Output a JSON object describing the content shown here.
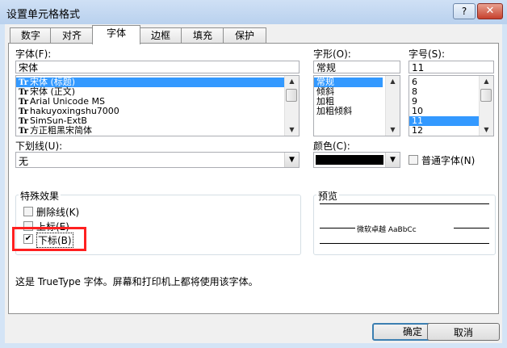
{
  "window": {
    "title": "设置单元格格式",
    "help_label": "?",
    "close_label": "✕"
  },
  "tabs": [
    {
      "label": "数字",
      "active": false
    },
    {
      "label": "对齐",
      "active": false
    },
    {
      "label": "字体",
      "active": true
    },
    {
      "label": "边框",
      "active": false
    },
    {
      "label": "填充",
      "active": false
    },
    {
      "label": "保护",
      "active": false
    }
  ],
  "font": {
    "label": "字体(F):",
    "value": "宋体",
    "items": [
      "宋体 (标题)",
      "宋体 (正文)",
      "Arial Unicode MS",
      "hakuyoxingshu7000",
      "SimSun-ExtB",
      "方正粗黑宋简体"
    ],
    "selected_index": 0,
    "icon_glyph": "Tr"
  },
  "style": {
    "label": "字形(O):",
    "value": "常规",
    "items": [
      "常规",
      "倾斜",
      "加粗",
      "加粗倾斜"
    ],
    "selected_index": 0
  },
  "size": {
    "label": "字号(S):",
    "value": "11",
    "items": [
      "6",
      "8",
      "9",
      "10",
      "11",
      "12"
    ],
    "selected_index": 4
  },
  "underline": {
    "label": "下划线(U):",
    "value": "无"
  },
  "color": {
    "label": "颜色(C):",
    "swatch": "#000000"
  },
  "normal_font": {
    "label": "普通字体(N)",
    "checked": false
  },
  "effects": {
    "title": "特殊效果",
    "strikethrough": {
      "label": "删除线(K)",
      "checked": false
    },
    "superscript": {
      "label": "上标(E)",
      "checked": false
    },
    "subscript": {
      "label": "下标(B)",
      "checked": true
    }
  },
  "preview": {
    "title": "预览",
    "sample": "微软卓越  AaBbCc"
  },
  "info_text": "这是 TrueType 字体。屏幕和打印机上都将使用该字体。",
  "buttons": {
    "ok": "确定",
    "cancel": "取消"
  },
  "highlight_color": "#ff2020",
  "selection_color": "#3399ff"
}
